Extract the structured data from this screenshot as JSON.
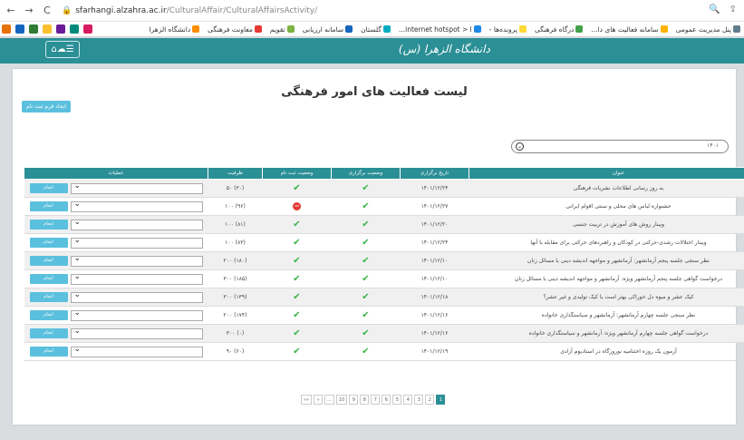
{
  "browser": {
    "url_host": "sfarhangi.alzahra.ac.ir",
    "url_path": "/CulturalAffair/CulturalAffairsActivity/",
    "bookmarks": [
      "پنل مدیریت عمومی",
      "سامانه فعالیت های دا...",
      "درگاه فرهنگی",
      "پرونده‌ها -",
      "internet hotspot > l...",
      "گلستان",
      "سامانه ارزیابی",
      "تقویم",
      "معاونت فرهنگی",
      "دانشگاه الزهرا"
    ]
  },
  "header": {
    "logo": "دانشگاه الزهرا (س)"
  },
  "page": {
    "title": "لیست فعالیت های امور فرهنگی",
    "form_button": "ایجاد فرم ثبت نام",
    "search_value": "۱۴۰۱"
  },
  "table": {
    "columns": [
      "عنوان",
      "تاریخ برگزاری",
      "وضعیت برگزاری",
      "وضعیت ثبت نام",
      "ظرفیت",
      "عملیات"
    ],
    "action_label": "انجام",
    "rows": [
      {
        "title": "به روز رسانی اطلاعات نشریات فرهنگی",
        "date": "۱۴۰۱/۱۲/۲۴",
        "held": "ok",
        "reg": "ok",
        "capacity": "(۳۰) ۵۰"
      },
      {
        "title": "جشنواره لباس های محلی و سنتی اقوام ایرانی",
        "date": "۱۴۰۱/۱۲/۲۷",
        "held": "ok",
        "reg": "no",
        "capacity": "(۹۶) ۱۰۰"
      },
      {
        "title": "وبینار روش های آموزش در تربیت جنسی",
        "date": "۱۴۰۱/۱۲/۲۰",
        "held": "ok",
        "reg": "ok",
        "capacity": "(۸۱) ۱۰۰"
      },
      {
        "title": "وبینار اختلالات رشدی-حرکتی در کودکان و راهبردهای حرکتی برای مقابله با آنها",
        "date": "۱۴۰۱/۱۲/۲۴",
        "held": "ok",
        "reg": "ok",
        "capacity": "(۸۳) ۱۰۰"
      },
      {
        "title": "نظر سنجی جلسه پنجم آرمانشهر: آرمانشهر و مواجهه اندیشه دینی با مسائل زنان",
        "date": "۱۴۰۱/۱۲/۱۰",
        "held": "ok",
        "reg": "ok",
        "capacity": "(۱۸۰) ۲۰۰"
      },
      {
        "title": "درخواست گواهی جلسه پنجم آرمانشهر ویژه: آرمانشهر و مواجهه اندیشه دینی با مسائل زنان",
        "date": "۱۴۰۱/۱۲/۱۰",
        "held": "ok",
        "reg": "ok",
        "capacity": "(۱۸۵) ۳۰۰"
      },
      {
        "title": "کیک عشر و میوه دل خوراکی بهتر است یا کیک تولیدی و غیر عشر؟",
        "date": "۱۴۰۱/۱۲/۱۸",
        "held": "ok",
        "reg": "ok",
        "capacity": "(۱۳۹) ۳۰۰"
      },
      {
        "title": "نظر سنجی جلسه چهارم آرمانشهر: آرمانشهر و سیاستگذاری خانواده",
        "date": "۱۴۰۱/۱۲/۱۶",
        "held": "ok",
        "reg": "ok",
        "capacity": "(۱۷۴) ۲۰۰"
      },
      {
        "title": "درخواست گواهی جلسه چهارم آرمانشهر ویژه: آرمانشهر و سیاستگذاری خانواده",
        "date": "۱۴۰۱/۱۲/۱۶",
        "held": "ok",
        "reg": "ok",
        "capacity": "(۰) ۳۰۰"
      },
      {
        "title": "آزمون یک روزه اختتامیه نوروزگاه در استادیوم آزادی",
        "date": "۱۴۰۱/۱۲/۱۹",
        "held": "ok",
        "reg": "ok",
        "capacity": "(۶۰) ۹۰"
      }
    ]
  },
  "pagination": {
    "items": [
      "»»",
      "»",
      "...",
      "10",
      "9",
      "8",
      "7",
      "6",
      "5",
      "4",
      "3",
      "2",
      "1"
    ],
    "active": "1"
  },
  "colors": {
    "header": "#2b8f96",
    "action": "#5bc0de",
    "ok": "#3bb44a",
    "no": "#e53935"
  }
}
